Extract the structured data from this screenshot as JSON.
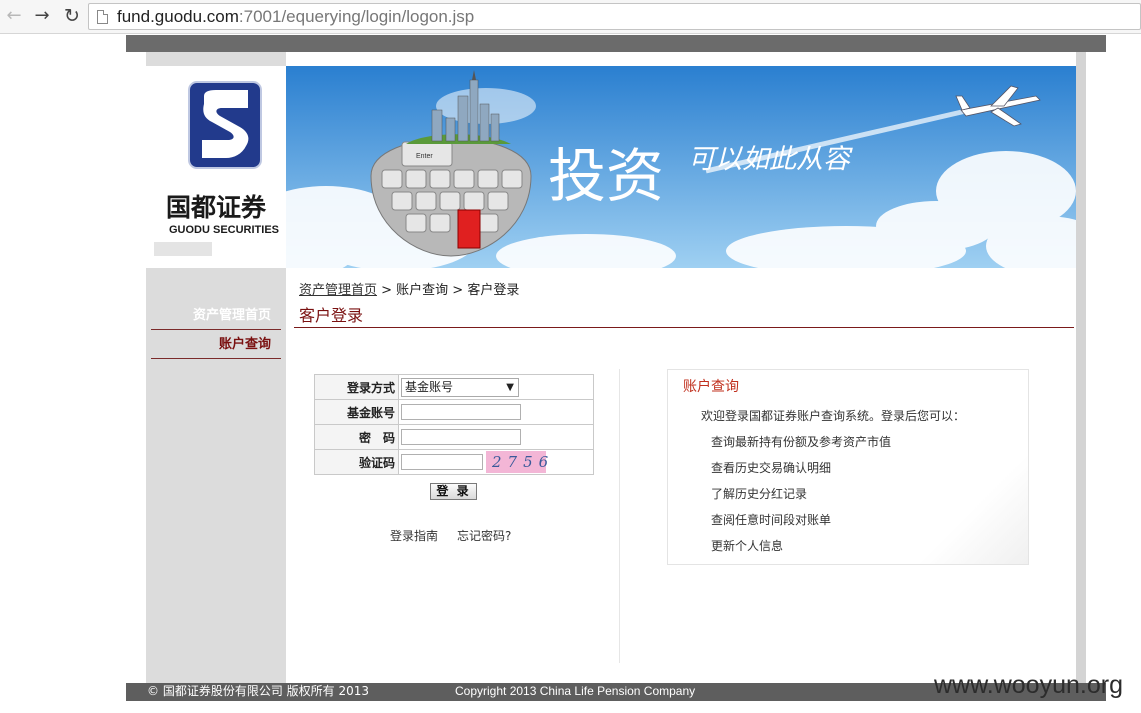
{
  "browser": {
    "url_host": "fund.guodu.com",
    "url_path": ":7001/equerying/login/logon.jsp"
  },
  "brand": {
    "logo_cn": "国都证券",
    "logo_en": "GUODU SECURITIES"
  },
  "banner": {
    "headline": "投资",
    "tagline": "可以如此从容",
    "key_label": "Enter"
  },
  "sidebar": {
    "items": [
      {
        "label": "资产管理首页"
      },
      {
        "label": "账户查询"
      }
    ]
  },
  "breadcrumb": {
    "home": "资产管理首页",
    "rest": " > 账户查询 > 客户登录"
  },
  "page_title": "客户登录",
  "login_form": {
    "method_label": "登录方式",
    "method_value": "基金账号",
    "account_label": "基金账号",
    "account_value": "",
    "password_label": "密　码",
    "password_value": "",
    "captcha_label": "验证码",
    "captcha_value": "",
    "captcha_text": "2756",
    "submit_label": "登 录",
    "guide_link": "登录指南",
    "forgot_link": "忘记密码?"
  },
  "info": {
    "title": "账户查询",
    "intro": "欢迎登录国都证券账户查询系统。登录后您可以：",
    "items": [
      "查询最新持有份额及参考资产市值",
      "查看历史交易确认明细",
      "了解历史分红记录",
      "查阅任意时间段对账单",
      "更新个人信息"
    ]
  },
  "footer": {
    "left": "© 国都证券股份有限公司 版权所有 2013",
    "right": "Copyright 2013 China Life Pension Company"
  },
  "watermark": "www.wooyun.org",
  "colors": {
    "brand_red": "#7a1010",
    "info_title": "#c0301e",
    "logo_blue": "#223a8c",
    "sky": "#3a8fd8"
  }
}
